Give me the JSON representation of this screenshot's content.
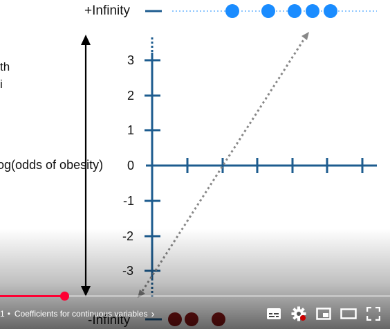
{
  "diagram": {
    "top_label": "+Infinity",
    "bottom_label": "-Infinity",
    "y_axis_label": "log(odds of obesity)",
    "partial_left_text": [
      "th",
      "i"
    ],
    "y_ticks": [
      "3",
      "2",
      "1",
      "0",
      "-1",
      "-2",
      "-3"
    ],
    "colors": {
      "axis": "#1d5c8f",
      "top_dots": "#1a8cff",
      "bottom_dots": "#8a1515",
      "dashed_line": "#888888",
      "arrow": "#000000"
    }
  },
  "player": {
    "progress_fraction": 0.165,
    "chapter_number": "1",
    "chapter_separator": "•",
    "chapter_title": "Coefficients for continuous variables",
    "chapter_chevron": "›",
    "buttons": [
      "subtitles-icon",
      "settings-icon",
      "miniplayer-icon",
      "theater-mode-icon",
      "fullscreen-icon"
    ],
    "colors": {
      "progress": "#ff0033",
      "icons": "#ffffff"
    }
  }
}
